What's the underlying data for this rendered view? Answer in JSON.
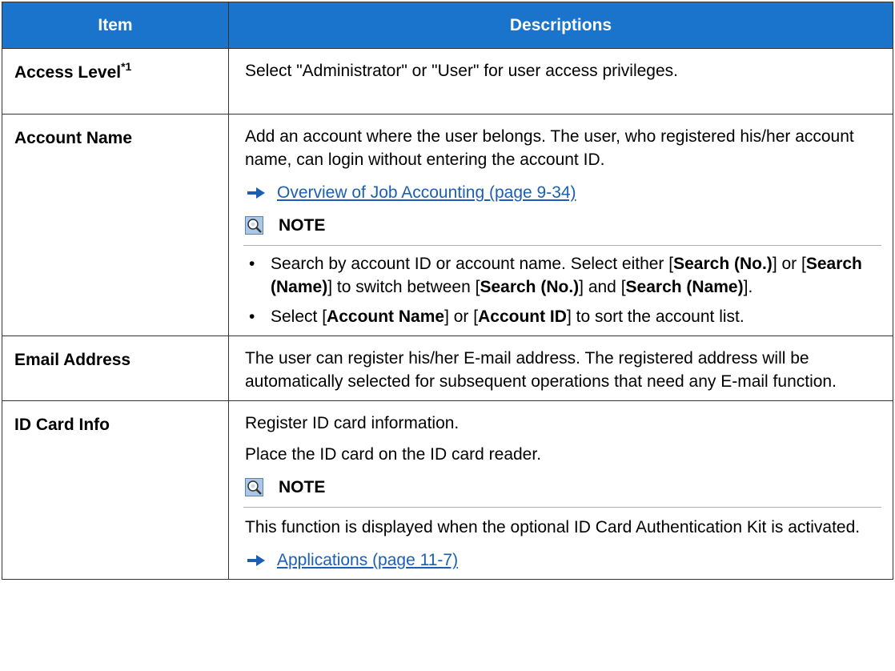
{
  "header": {
    "item": "Item",
    "descriptions": "Descriptions"
  },
  "rows": {
    "access_level": {
      "item": "Access Level",
      "footnote": "*1",
      "desc": "Select \"Administrator\" or \"User\" for user access privileges."
    },
    "account_name": {
      "item": "Account Name",
      "desc": "Add an account where the user belongs. The user, who registered his/her account name, can login without entering the account ID.",
      "link": "Overview of Job Accounting (page 9-34)",
      "note_label": "NOTE",
      "bullet1": {
        "p1": "Search by account ID or account name. Select either [",
        "b1": "Search (No.)",
        "p2": "] or [",
        "b2": "Search (Name)",
        "p3": "] to switch between [",
        "b3": "Search (No.)",
        "p4": "] and [",
        "b4": "Search (Name)",
        "p5": "]."
      },
      "bullet2": {
        "p1": "Select [",
        "b1": "Account Name",
        "p2": "] or [",
        "b2": "Account ID",
        "p3": "] to sort the account list."
      }
    },
    "email_address": {
      "item": "Email Address",
      "desc": "The user can register his/her E-mail address. The registered address will be automatically selected for subsequent operations that need any E-mail function."
    },
    "id_card_info": {
      "item": "ID Card Info",
      "desc1": "Register ID card information.",
      "desc2": "Place the ID card on the ID card reader.",
      "note_label": "NOTE",
      "note_text": "This function is displayed when the optional ID Card Authentication Kit is activated.",
      "link": "Applications (page 11-7)"
    }
  },
  "colors": {
    "header_bg": "#1b74cc",
    "link": "#1a5fb4",
    "icon_bg": "#a9c8e6"
  },
  "icons": {
    "note": "note-magnifier-icon",
    "arrow": "arrow-right-icon"
  }
}
